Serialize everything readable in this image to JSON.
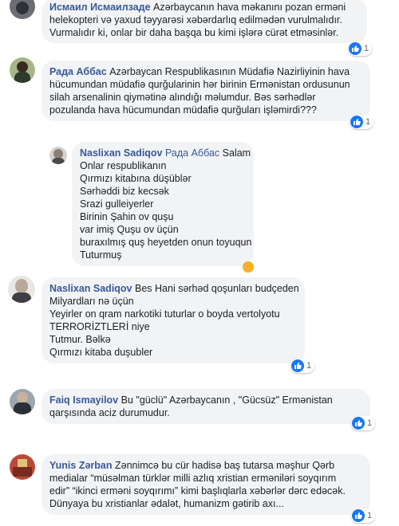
{
  "comments": [
    {
      "author": "Исмаил Исмаилзаде",
      "lines": [
        "Azərbaycanın hava məkanını pozan erməni",
        "helekopteri və yaxud təyyarəsi xəbərdarlıq edilmədən vurulmalıdır.",
        "Vurmalıdır ki, onlar bir daha başqa bu kimi işlərə cürət etməsinlər."
      ],
      "reaction_count": "1"
    },
    {
      "author": "Рада Аббас",
      "lines": [
        "Azərbaycan Respublikasının Müdafiə Nazirliyinin hava",
        "hücumundan müdafiə qurğularinin hər birinin Ermənistan ordusunun",
        "silah arsenalinin qiymətinə alındığı məlumdur. Bəs sərhədlər",
        "pozulanda hava hücumundan müdafiə qurğuları işləmirdi???"
      ],
      "reaction_count": "1"
    },
    {
      "author": "Naslixan Sadiqov",
      "mention": "Рада Аббас",
      "lines": [
        "Salam",
        "Onlar respublikanın",
        "Qırmızı kitabına düşüblər",
        "Sərhəddi biz kecsək",
        "Srazi gulleiyerler",
        "Birinin Şahin ov quşu",
        "var imiş Quşu ov üçün",
        "buraxılmış quş heyetden onun toyuqun",
        "Tuturmuş"
      ]
    },
    {
      "author": "Naslixan Sadiqov",
      "lines": [
        "Bes Hani sərhəd qoşunları budçeden",
        "Milyardları nə üçün",
        "Yeyirler on qram narkotiki tuturlar o boyda vertolyotu",
        "TERRORİZTLERİ niye",
        "Tutmur. Bəlkə",
        "Qırmızı kitaba duşubler"
      ],
      "reaction_count": "1"
    },
    {
      "author": "Faiq Ismayilov",
      "lines": [
        "Bu \"güclü\" Azərbaycanın , \"Gücsüz\" Ermənistan",
        "qarşısında aciz durumudur."
      ],
      "reaction_count": "1"
    },
    {
      "author": "Yunis Zərban",
      "lines": [
        "Zənnimcə bu cür hadisə baş tutarsa məşhur Qərb",
        "medialar “müsəlman türklər milli azlıq xristian erməniləri soyqırım",
        "edir” “ikinci erməni soyqırımı” kimi başlıqlarla xəbərlər dərc edəcək.",
        "Dünyaya bu xristianlar ədalət, humanizm gətirib axı..."
      ],
      "reaction_count": "1"
    }
  ],
  "colors": {
    "bubble": "#f2f3f5",
    "author": "#385898",
    "like": "#1877f2"
  },
  "icons": [
    "like-icon",
    "haha-icon"
  ]
}
